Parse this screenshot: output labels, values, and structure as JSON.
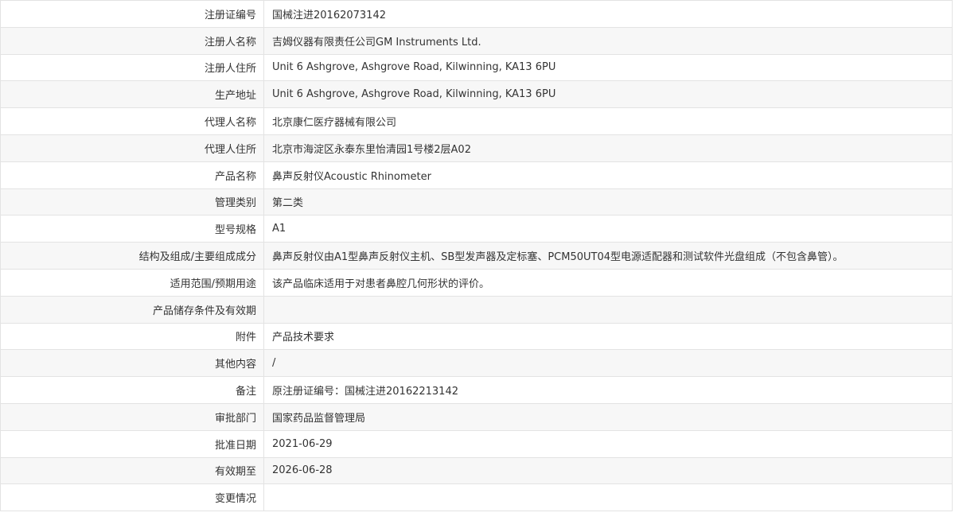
{
  "rows": [
    {
      "label": "注册证编号",
      "value": "国械注进20162073142"
    },
    {
      "label": "注册人名称",
      "value": "吉姆仪器有限责任公司GM Instruments Ltd."
    },
    {
      "label": "注册人住所",
      "value": "Unit 6 Ashgrove, Ashgrove Road, Kilwinning, KA13 6PU"
    },
    {
      "label": "生产地址",
      "value": "Unit 6 Ashgrove, Ashgrove Road, Kilwinning, KA13 6PU"
    },
    {
      "label": "代理人名称",
      "value": "北京康仁医疗器械有限公司"
    },
    {
      "label": "代理人住所",
      "value": "北京市海淀区永泰东里怡清园1号楼2层A02"
    },
    {
      "label": "产品名称",
      "value": "鼻声反射仪Acoustic Rhinometer"
    },
    {
      "label": "管理类别",
      "value": "第二类"
    },
    {
      "label": "型号规格",
      "value": "A1"
    },
    {
      "label": "结构及组成/主要组成成分",
      "value": "鼻声反射仪由A1型鼻声反射仪主机、SB型发声器及定标塞、PCM50UT04型电源适配器和测试软件光盘组成（不包含鼻管）。"
    },
    {
      "label": "适用范围/预期用途",
      "value": "该产品临床适用于对患者鼻腔几何形状的评价。"
    },
    {
      "label": "产品储存条件及有效期",
      "value": ""
    },
    {
      "label": "附件",
      "value": "产品技术要求"
    },
    {
      "label": "其他内容",
      "value": "/"
    },
    {
      "label": "备注",
      "value": "原注册证编号：国械注进20162213142"
    },
    {
      "label": "审批部门",
      "value": "国家药品监督管理局"
    },
    {
      "label": "批准日期",
      "value": "2021-06-29"
    },
    {
      "label": "有效期至",
      "value": "2026-06-28"
    },
    {
      "label": "变更情况",
      "value": ""
    }
  ]
}
